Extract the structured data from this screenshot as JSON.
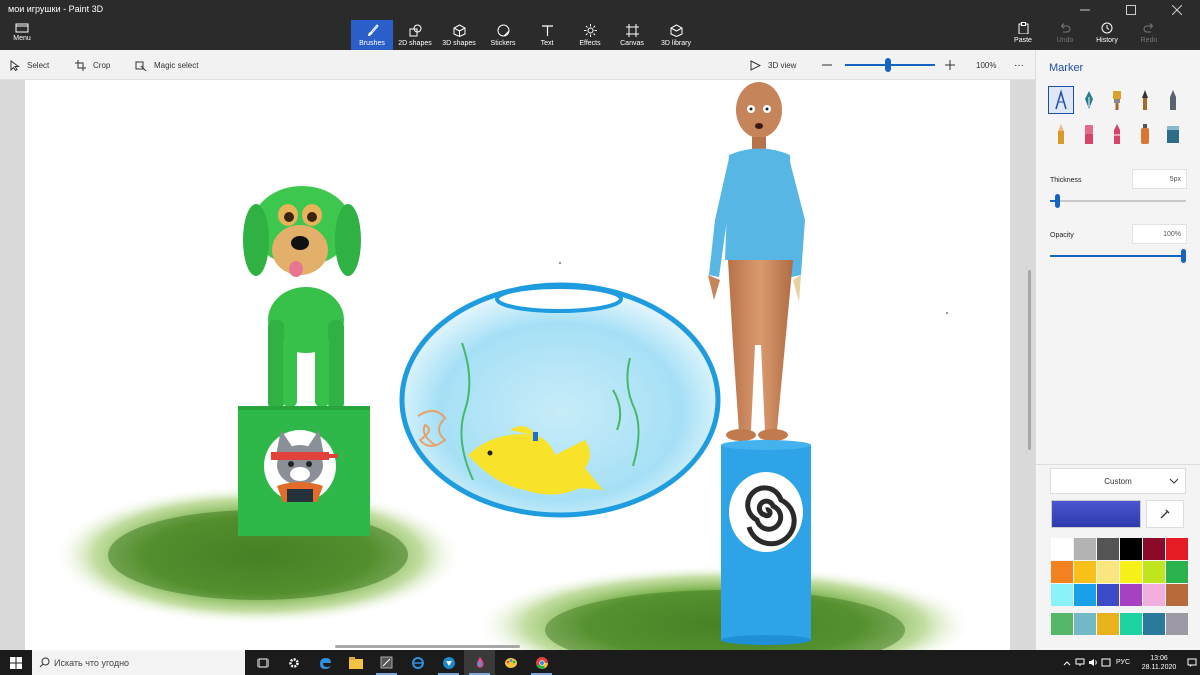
{
  "window": {
    "title": "мои игрушки - Paint 3D",
    "buttons": [
      "minimize",
      "maximize",
      "close"
    ]
  },
  "ribbon": {
    "menu_label": "Menu",
    "tools": [
      {
        "label": "Brushes",
        "icon": "brush-icon",
        "active": true
      },
      {
        "label": "2D shapes",
        "icon": "2d-shapes-icon"
      },
      {
        "label": "3D shapes",
        "icon": "3d-shapes-icon"
      },
      {
        "label": "Stickers",
        "icon": "stickers-icon"
      },
      {
        "label": "Text",
        "icon": "text-icon"
      },
      {
        "label": "Effects",
        "icon": "effects-icon"
      },
      {
        "label": "Canvas",
        "icon": "canvas-icon"
      },
      {
        "label": "3D library",
        "icon": "3d-library-icon"
      }
    ],
    "right_tools": [
      {
        "label": "Paste",
        "icon": "paste-icon",
        "enabled": true
      },
      {
        "label": "Undo",
        "icon": "undo-icon",
        "enabled": false
      },
      {
        "label": "History",
        "icon": "history-icon",
        "enabled": true
      },
      {
        "label": "Redo",
        "icon": "redo-icon",
        "enabled": false
      }
    ]
  },
  "toolbar": {
    "select_label": "Select",
    "crop_label": "Crop",
    "magic_select_label": "Magic select",
    "view_3d_label": "3D view",
    "zoom_value": "100%",
    "more_label": "···"
  },
  "panel": {
    "title": "Marker",
    "brushes": [
      {
        "name": "marker",
        "color": "#1f4fa6",
        "active": true
      },
      {
        "name": "calligraphy-pen",
        "color": "#2a7c8a"
      },
      {
        "name": "oil-brush",
        "color": "#d8a32a"
      },
      {
        "name": "watercolor",
        "color": "#a36a2a"
      },
      {
        "name": "pixel-pen",
        "color": "#5a6370"
      },
      {
        "name": "pencil",
        "color": "#d89a2a"
      },
      {
        "name": "eraser",
        "color": "#d8436a"
      },
      {
        "name": "crayon",
        "color": "#d8436a"
      },
      {
        "name": "spray-can",
        "color": "#d97730"
      },
      {
        "name": "fill",
        "color": "#2c6e8a"
      }
    ],
    "thickness_label": "Thickness",
    "thickness_value": "5px",
    "thickness_level": 0.05,
    "opacity_label": "Opacity",
    "opacity_value": "100%",
    "opacity_level": 1.0,
    "color_mode": "Custom",
    "current_color": "#3c4bc2",
    "palette": [
      "#ffffff",
      "#b3b3b3",
      "#555555",
      "#000000",
      "#8b0a2a",
      "#e51c23",
      "#f58220",
      "#f7c01b",
      "#fbe57f",
      "#f7f11a",
      "#bfe51e",
      "#2bb24c",
      "#8bf2f7",
      "#1aa0e6",
      "#3e4bc9",
      "#a642c2",
      "#f2aedc",
      "#b86b3a"
    ],
    "custom_colors": [
      "#56b768",
      "#73b8c6",
      "#e7b21d",
      "#1ed3a2",
      "#2b7a9a",
      "#9e9aa5"
    ]
  },
  "taskbar": {
    "search_placeholder": "Искать что угодно",
    "apps": [
      {
        "name": "task-view-icon"
      },
      {
        "name": "settings-icon"
      },
      {
        "name": "edge-icon"
      },
      {
        "name": "file-explorer-icon"
      },
      {
        "name": "snipping-tool-icon"
      },
      {
        "name": "internet-explorer-icon"
      },
      {
        "name": "app-icon"
      },
      {
        "name": "paint-3d-icon",
        "active": true
      },
      {
        "name": "paint-icon"
      },
      {
        "name": "chrome-icon"
      }
    ],
    "language": "РУС",
    "time": "13:06",
    "date": "28.11.2020"
  }
}
